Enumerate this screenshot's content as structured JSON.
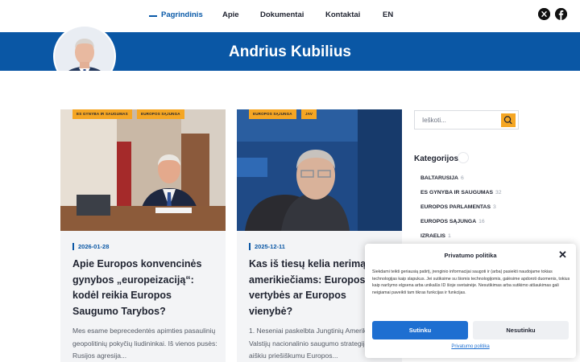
{
  "nav": {
    "items": [
      {
        "label": "Pagrindinis",
        "active": true
      },
      {
        "label": "Apie"
      },
      {
        "label": "Dokumentai"
      },
      {
        "label": "Kontaktai"
      },
      {
        "label": "EN"
      }
    ],
    "social": [
      "x-icon",
      "facebook-icon"
    ]
  },
  "banner": {
    "title": "Andrius Kubilius"
  },
  "posts": [
    {
      "tags": [
        "ES GYNYBA IR SAUGUMAS",
        "EUROPOS SĄJUNGA"
      ],
      "date": "2026-01-28",
      "title": "Apie Europos konvencinės gynybos „europeizaciją“: kodėl reikia Europos Saugumo Tarybos?",
      "excerpt": "Mes esame beprecedentės apimties pasaulinių geopolitinių pokyčių liudininkai. Iš vienos pusės: Rusijos agresija..."
    },
    {
      "tags": [
        "EUROPOS SĄJUNGA",
        "JAV"
      ],
      "date": "2025-12-11",
      "title": "Kas iš tiesų kelia nerimą amerikiečiams: Europos vertybės ar Europos vienybė?",
      "excerpt": "1. Neseniai paskelbta Jungtinių Amerikos Valstijų nacionalinio saugumo strategija stebina aiškiu priešiškumu Europos..."
    }
  ],
  "sidebar": {
    "search_placeholder": "Ieškoti...",
    "categories_title": "Kategorijos",
    "categories": [
      {
        "name": "BALTARUSIJA",
        "count": "6"
      },
      {
        "name": "ES GYNYBA IR SAUGUMAS",
        "count": "32"
      },
      {
        "name": "EUROPOS PARLAMENTAS",
        "count": "3"
      },
      {
        "name": "EUROPOS SĄJUNGA",
        "count": "16"
      },
      {
        "name": "IZRAELIS",
        "count": "1"
      }
    ]
  },
  "cookie": {
    "title": "Privatumo politika",
    "text": "Siekdami teikti geriausią patirtį, įrenginio informacijai saugoti ir (arba) pasiekti naudojame tokias technologijas kaip slapukus. Jei sutiksime su šiomis technologijomis, galėsime apdoroti duomenis, tokius kaip naršymo elgsena arba unikalūs ID šioje svetainėje. Nesutikimas arba sutikimo atšaukimas gali neigiamai paveikti tam tikras funkcijas ir funkcijas.",
    "accept": "Sutinku",
    "decline": "Nesutinku",
    "link": "Privatumo politika"
  },
  "colors": {
    "brand": "#0a57a5",
    "accent": "#f5a623",
    "button": "#1e6fd1"
  }
}
